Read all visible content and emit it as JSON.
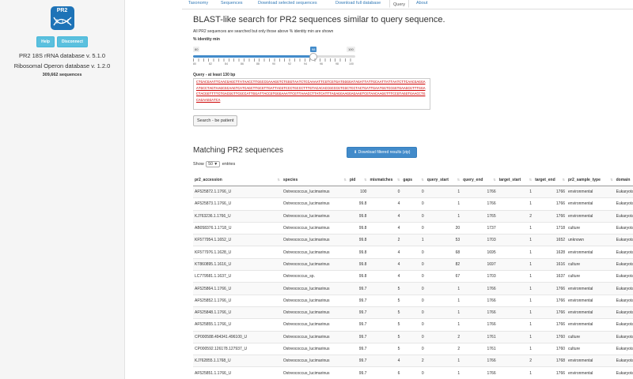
{
  "sidebar": {
    "logo_text": "PR2",
    "help_label": "Help",
    "disconnect_label": "Disconnect",
    "db_line1": "PR2 18S rRNA database v. 5.1.0",
    "db_line2": "Ribosomal Operon database v. 1.2.0",
    "seq_count": "309,662 sequences"
  },
  "tabs": [
    {
      "label": "Taxonomy"
    },
    {
      "label": "Sequences"
    },
    {
      "label": "Download selected sequences"
    },
    {
      "label": "Download full database"
    },
    {
      "label": "Query"
    },
    {
      "label": "About"
    }
  ],
  "blast": {
    "title": "BLAST-like search for PR2 sequences similar to query sequence.",
    "subtitle": "All PR2 sequences are searched but only those above % identity min are shown",
    "identity_label": "% identity min",
    "slider_min": "80",
    "slider_max": "100",
    "slider_value": "98",
    "slider_value_fraction": 0.9,
    "tick_labels": [
      "80",
      "82",
      "84",
      "86",
      "88",
      "90",
      "92",
      "94",
      "96",
      "98",
      "100"
    ],
    "query_label": "Query - at least 130 bp",
    "query_sequence": "CTGACGAATTCAACGAGCTTATAACCTTGGCCGAAAGGTCTGGGTAATCTCCAAAATTCGTCGTGATGGGGATAGATTATTGCAATTATTAATCTTCAACGAGGAATGCCTAGTAAGCGCAAGTCATCAGCTTGCGTTGATTACGTCCCTGCCCTTTGTACACACCGCCCGTCGCTCCTACTGATTGAATGGTCCGGTGAAGCGTTTGGACTACGGTTTTCTGACGGTTCGCCATTGGATTACCGTGGGAAATTCGTTAAACCTTATCATTTAGAGGAAGGAGAAGTCGTAACAAGGTTTCCGTAGGTGAACCTGCAGAAGGATCA",
    "search_label": "Search - be patient"
  },
  "results": {
    "title": "Matching PR2 sequences",
    "download_label": "Download filtered results (zip)",
    "show_label": "Show",
    "show_value": "50",
    "entries_label": "entries",
    "columns": [
      "pr2_accession",
      "species",
      "pid",
      "mismatches",
      "gaps",
      "query_start",
      "query_end",
      "target_start",
      "target_end",
      "pr2_sample_type",
      "domain"
    ],
    "rows": [
      [
        "AF525872.1.1766_U",
        "Ostreococcus_lucimarinus",
        "100",
        "0",
        "0",
        "1",
        "1766",
        "1",
        "1766",
        "environmental",
        "Eukaryota"
      ],
      [
        "AF525873.1.1766_U",
        "Ostreococcus_lucimarinus",
        "99.8",
        "4",
        "0",
        "1",
        "1766",
        "1",
        "1766",
        "environmental",
        "Eukaryota"
      ],
      [
        "KJ763236.1.1766_U",
        "Ostreococcus_lucimarinus",
        "99.8",
        "4",
        "0",
        "1",
        "1765",
        "2",
        "1766",
        "environmental",
        "Eukaryota"
      ],
      [
        "AB058376.1.1718_U",
        "Ostreococcus_lucimarinus",
        "99.8",
        "4",
        "0",
        "20",
        "1737",
        "1",
        "1718",
        "culture",
        "Eukaryota"
      ],
      [
        "KF577954.1.1652_U",
        "Ostreococcus_lucimarinus",
        "99.8",
        "2",
        "1",
        "53",
        "1703",
        "1",
        "1652",
        "unknown",
        "Eukaryota"
      ],
      [
        "KF577976.1.1628_U",
        "Ostreococcus_lucimarinus",
        "99.8",
        "4",
        "0",
        "68",
        "1695",
        "1",
        "1628",
        "environmental",
        "Eukaryota"
      ],
      [
        "KT860895.1.1616_U",
        "Ostreococcus_lucimarinus",
        "99.8",
        "4",
        "0",
        "82",
        "1697",
        "1",
        "1616",
        "culture",
        "Eukaryota"
      ],
      [
        "LC779581.1.1637_U",
        "Ostreococcus_sp.",
        "99.8",
        "4",
        "0",
        "67",
        "1703",
        "1",
        "1637",
        "culture",
        "Eukaryota"
      ],
      [
        "AF525864.1.1766_U",
        "Ostreococcus_lucimarinus",
        "99.7",
        "5",
        "0",
        "1",
        "1766",
        "1",
        "1766",
        "environmental",
        "Eukaryota"
      ],
      [
        "AF525852.1.1766_U",
        "Ostreococcus_lucimarinus",
        "99.7",
        "5",
        "0",
        "1",
        "1766",
        "1",
        "1766",
        "environmental",
        "Eukaryota"
      ],
      [
        "AF525848.1.1766_U",
        "Ostreococcus_lucimarinus",
        "99.7",
        "5",
        "0",
        "1",
        "1766",
        "1",
        "1766",
        "environmental",
        "Eukaryota"
      ],
      [
        "AF525855.1.1766_U",
        "Ostreococcus_lucimarinus",
        "99.7",
        "5",
        "0",
        "1",
        "1766",
        "1",
        "1766",
        "environmental",
        "Eukaryota"
      ],
      [
        "CP000588.494341.496100_U",
        "Ostreococcus_lucimarinus",
        "99.7",
        "5",
        "0",
        "2",
        "1761",
        "1",
        "1760",
        "culture",
        "Eukaryota"
      ],
      [
        "CP000592.126178.127937_U",
        "Ostreococcus_lucimarinus",
        "99.7",
        "5",
        "0",
        "2",
        "1761",
        "1",
        "1760",
        "culture",
        "Eukaryota"
      ],
      [
        "KJ762855.1.1768_U",
        "Ostreococcus_lucimarinus",
        "99.7",
        "4",
        "2",
        "1",
        "1766",
        "2",
        "1768",
        "environmental",
        "Eukaryota"
      ],
      [
        "AF525851.1.1766_U",
        "Ostreococcus_lucimarinus",
        "99.7",
        "6",
        "0",
        "1",
        "1766",
        "1",
        "1766",
        "environmental",
        "Eukaryota"
      ]
    ]
  }
}
